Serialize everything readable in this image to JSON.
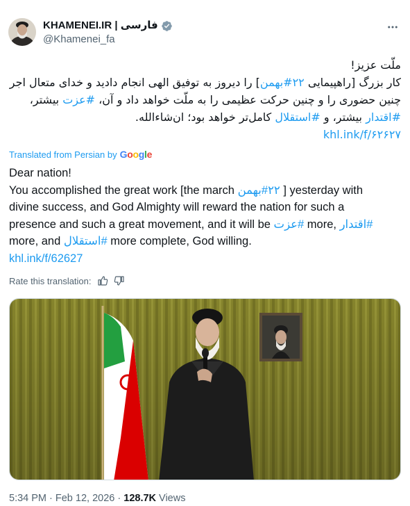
{
  "account": {
    "display_name": "KHAMENEI.IR | فارسی",
    "handle": "@Khamenei_fa",
    "more_icon": "more-horizontal-icon",
    "verified_color": "#829aab"
  },
  "tweet_fa": {
    "lines": [
      [
        "ملّت عزیز!"
      ],
      [
        "کار بزرگ [راهپیمایی ",
        "#۲۲بهمن",
        "] را دیروز به توفیق الهی انجام دادید و خدای متعال اجر"
      ],
      [
        "چنین حضوری را و چنین حرکت عظیمی را به ملّت خواهد داد و آن، ",
        "#عزت",
        " بیشتر،"
      ],
      [
        "#اقتدار",
        " بیشتر، و ",
        "#استقلال",
        " کامل‌تر خواهد بود؛ ان‌شاءالله."
      ],
      [
        "khl.ink/f/۶۲۶۲۷"
      ]
    ]
  },
  "translation": {
    "label": "Translated from Persian by",
    "provider": "Google",
    "lines": [
      [
        "Dear nation!"
      ],
      [
        "You accomplished the great work [the march ",
        "#۲۲بهمن",
        " ] yesterday with"
      ],
      [
        "divine success, and God Almighty will reward the nation for such a"
      ],
      [
        "presence and such a great movement, and it will be ",
        "#عزت",
        " more, ",
        "#اقتدار"
      ],
      [
        "more, and ",
        "#استقلال",
        " more complete, God willing."
      ],
      [
        "khl.ink/f/62627"
      ]
    ],
    "rate_label": "Rate this translation:"
  },
  "footer": {
    "time": "5:34 PM",
    "sep1": " · ",
    "date": "Feb 12, 2026",
    "sep2": " · ",
    "views_count": "128.7K",
    "views_label": " Views"
  },
  "colors": {
    "link": "#1d9bf0",
    "secondary_text": "#536471",
    "curtain": "#8c8a2e"
  }
}
